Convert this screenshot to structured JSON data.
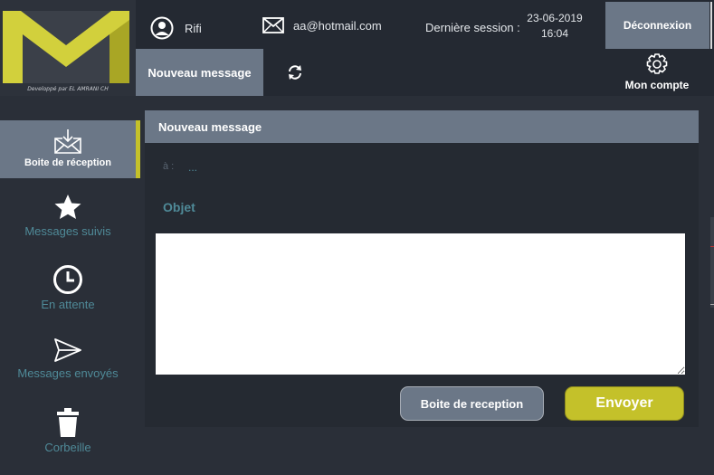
{
  "logo": {
    "caption": "Developpé par EL AMRANI CH",
    "icon": "envelope-logo",
    "colors": {
      "primary": "#d2d03c",
      "dark": "#a9a625",
      "bg": "#3b4049"
    }
  },
  "header": {
    "user": {
      "icon": "user-icon",
      "name": "Rifi"
    },
    "mail": {
      "icon": "envelope-icon",
      "address": "aa@hotmail.com"
    },
    "session": {
      "label": "Dernière session :",
      "date": "23-06-2019",
      "time": "16:04"
    },
    "logout_label": "Déconnexion"
  },
  "toolbar": {
    "new_message_tab": "Nouveau message",
    "refresh_icon": "refresh-icon",
    "account": {
      "icon": "gear-icon",
      "label": "Mon compte"
    }
  },
  "sidebar": {
    "items": [
      {
        "label": "Boite de réception",
        "icon": "inbox-icon",
        "active": true
      },
      {
        "label": "Messages suivis",
        "icon": "star-icon",
        "active": false
      },
      {
        "label": "En attente",
        "icon": "clock-icon",
        "active": false
      },
      {
        "label": "Messages envoyés",
        "icon": "send-icon",
        "active": false
      },
      {
        "label": "Corbeille",
        "icon": "trash-icon",
        "active": false
      }
    ]
  },
  "compose": {
    "title": "Nouveau message",
    "to_label": "à :",
    "to_value": "...",
    "subject_label": "Objet",
    "body_value": "",
    "inbox_button": "Boite de reception",
    "send_button": "Envoyer"
  },
  "colors": {
    "accent": "#c4c12a",
    "slate": "#6b7787",
    "teal": "#4f8a98",
    "bg": "#2a2f38"
  }
}
